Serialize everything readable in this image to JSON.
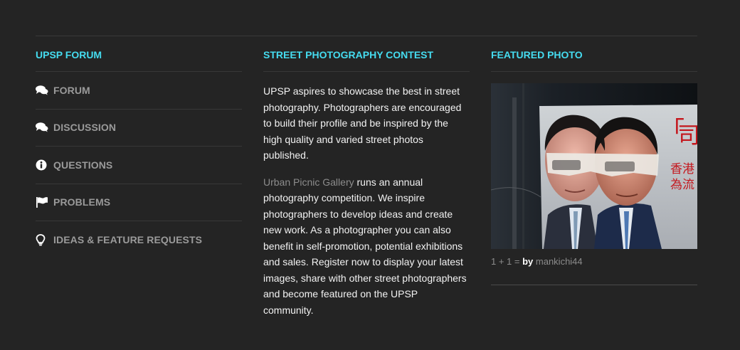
{
  "forum": {
    "heading": "UPSP FORUM",
    "items": [
      {
        "label": "FORUM",
        "icon": "chat-bubbles-icon"
      },
      {
        "label": "DISCUSSION",
        "icon": "chat-bubbles-icon"
      },
      {
        "label": "QUESTIONS",
        "icon": "info-circle-icon"
      },
      {
        "label": "PROBLEMS",
        "icon": "flag-icon"
      },
      {
        "label": "IDEAS & FEATURE REQUESTS",
        "icon": "lightbulb-icon"
      }
    ]
  },
  "contest": {
    "heading": "STREET PHOTOGRAPHY CONTEST",
    "paragraph1": "UPSP aspires to showcase the best in street photography. Photographers are encouraged to build their profile and be inspired by the high quality and varied street photos published.",
    "gallery_link": "Urban Picnic Gallery",
    "paragraph2_rest": " runs an annual photography competition. We inspire photographers to develop ideas and create new work. As a photographer you can also benefit in self-promotion, potential exhibitions and sales. Register now to display your latest images, share with other street photographers and become featured on the UPSP community."
  },
  "featured": {
    "heading": "FEATURED PHOTO",
    "title": "1 + 1 = ",
    "by": "by",
    "author": "mankichi44",
    "poster_chars": [
      "「",
      "司",
      "香港",
      "為流"
    ]
  },
  "colors": {
    "accent": "#45dcf0",
    "background": "#242424",
    "muted": "#9a9a9a"
  }
}
